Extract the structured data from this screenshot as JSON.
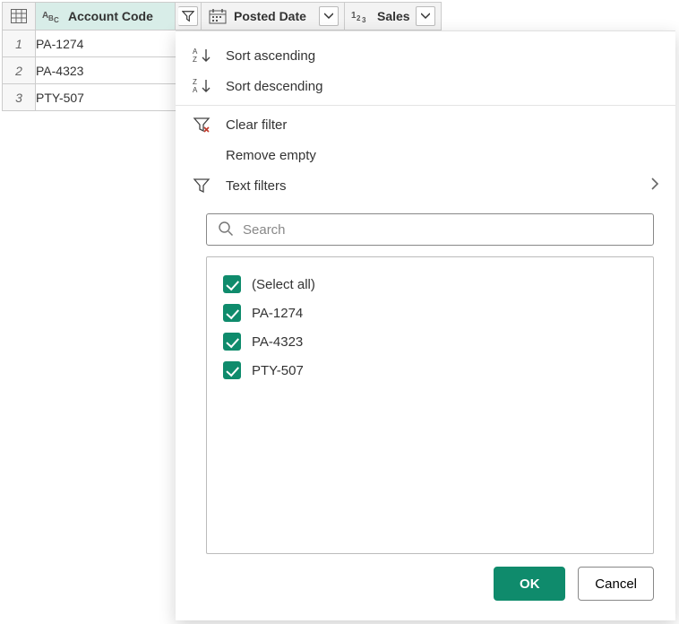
{
  "columns": {
    "account_code": {
      "label": "Account Code",
      "type_icon": "text-icon"
    },
    "posted_date": {
      "label": "Posted Date",
      "type_icon": "date-icon"
    },
    "sales": {
      "label": "Sales",
      "type_icon": "number-icon"
    }
  },
  "rows": [
    {
      "n": "1",
      "account_code": "PA-1274"
    },
    {
      "n": "2",
      "account_code": "PA-4323"
    },
    {
      "n": "3",
      "account_code": "PTY-507"
    }
  ],
  "menu": {
    "sort_asc": "Sort ascending",
    "sort_desc": "Sort descending",
    "clear": "Clear filter",
    "remove_empty": "Remove empty",
    "text_filters": "Text filters"
  },
  "search": {
    "placeholder": "Search"
  },
  "checklist": {
    "select_all": "(Select all)",
    "items": [
      "PA-1274",
      "PA-4323",
      "PTY-507"
    ]
  },
  "buttons": {
    "ok": "OK",
    "cancel": "Cancel"
  }
}
